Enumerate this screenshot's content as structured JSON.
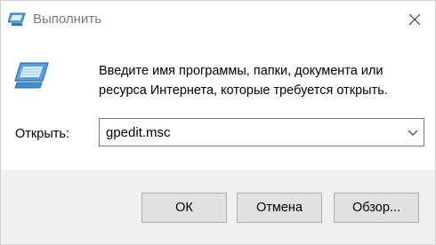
{
  "window": {
    "title": "Выполнить",
    "close_icon": "close-icon"
  },
  "content": {
    "description": "Введите имя программы, папки, документа или ресурса Интернета, которые требуется открыть.",
    "open_label": "Открыть:",
    "command_value": "gpedit.msc",
    "icon": "run-icon"
  },
  "buttons": {
    "ok": "ОК",
    "cancel": "Отмена",
    "browse": "Обзор..."
  },
  "colors": {
    "accent": "#3c8fd6",
    "footer": "#f0f0f0",
    "button": "#e1e1e1"
  }
}
